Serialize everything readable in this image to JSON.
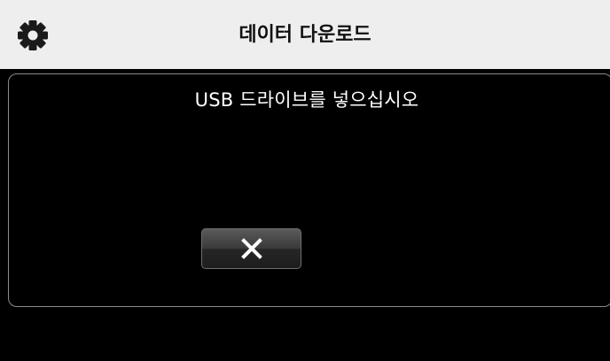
{
  "header": {
    "title": "데이터 다운로드",
    "settings_icon": "gear-icon"
  },
  "dialog": {
    "message": "USB 드라이브를 넣으십시오",
    "cancel_icon": "close-icon"
  },
  "colors": {
    "header_bg": "#eeeeee",
    "background": "#000000",
    "dialog_border": "#8a8a8a",
    "text_light": "#ffffff",
    "text_dark": "#111111"
  }
}
